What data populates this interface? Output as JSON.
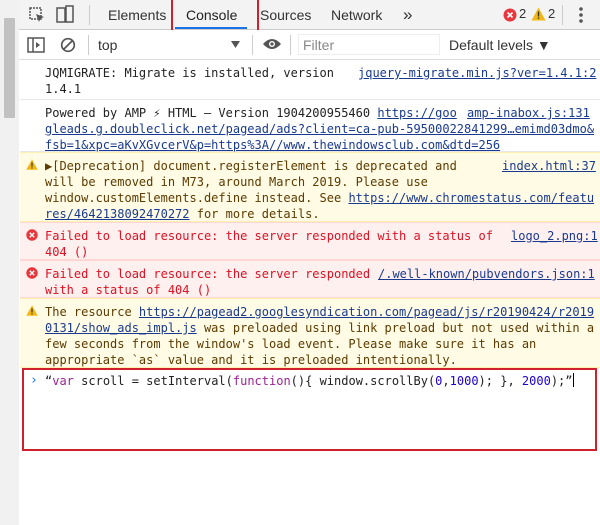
{
  "tabs": {
    "elements": "Elements",
    "console": "Console",
    "sources": "Sources",
    "network": "Network",
    "more": "»"
  },
  "badges": {
    "errors": "2",
    "warnings": "2"
  },
  "toolbar": {
    "context": "top",
    "filter_placeholder": "Filter",
    "levels": "Default levels ▼"
  },
  "messages": {
    "jqmigrate": {
      "line1": "JQMIGRATE: Migrate is installed, version",
      "line2": "1.4.1",
      "source": "jquery-migrate.min.js?ver=1.4.1:2"
    },
    "amp": {
      "prefix": "Powered by AMP ⚡ HTML – Version 1904200955460 ",
      "link1": "https://goo",
      "source": "amp-inabox.js:131",
      "line2": "gleads.g.doubleclick.net/pagead/ads?client=ca-pub-59500022841299…emimd03dmo&",
      "line3": "fsb=1&xpc=aKvXGvcerV&p=https%3A//www.thewindowsclub.com&dtd=256"
    },
    "deprecation": {
      "line1": "▶[Deprecation] document.registerElement is deprecated and",
      "source": "index.html:37",
      "line2": "will be removed in M73, around March 2019. Please use",
      "line3a": "window.customElements.define instead. See ",
      "line3link": "https://www.chromestatus.com/featu",
      "line4link": "res/4642138092470272",
      "line4b": " for more details."
    },
    "error1": {
      "line1": "Failed to load resource: the server responded with a status of",
      "source": "logo_2.png:1",
      "line2": "404 ()"
    },
    "error2": {
      "line1": "Failed to load resource: the server responded ",
      "source": "/.well-known/pubvendors.json:1",
      "line2": "with a status of 404 ()"
    },
    "preload": {
      "line1a": "The resource ",
      "line1link": "https://pagead2.googlesyndication.com/pagead/js/r20190424/r2019",
      "line2link": "0131/show_ads_impl.js",
      "line2b": " was preloaded using link preload but not used within a",
      "line3": "few seconds from the window's load event. Please make sure it has an",
      "line4": "appropriate `as` value and it is preloaded intentionally."
    }
  },
  "prompt": {
    "caret": "›",
    "open_quote": "“",
    "var_kw": "var",
    "part1": " scroll = setInterval(",
    "function_kw": "function",
    "part2": "(){ window.scrollBy(",
    "n0": "0",
    "comma1": ",",
    "n1000": "1000",
    "part3": "); }, ",
    "n2000": "2000",
    "part4": ");",
    "close_quote": "”"
  }
}
